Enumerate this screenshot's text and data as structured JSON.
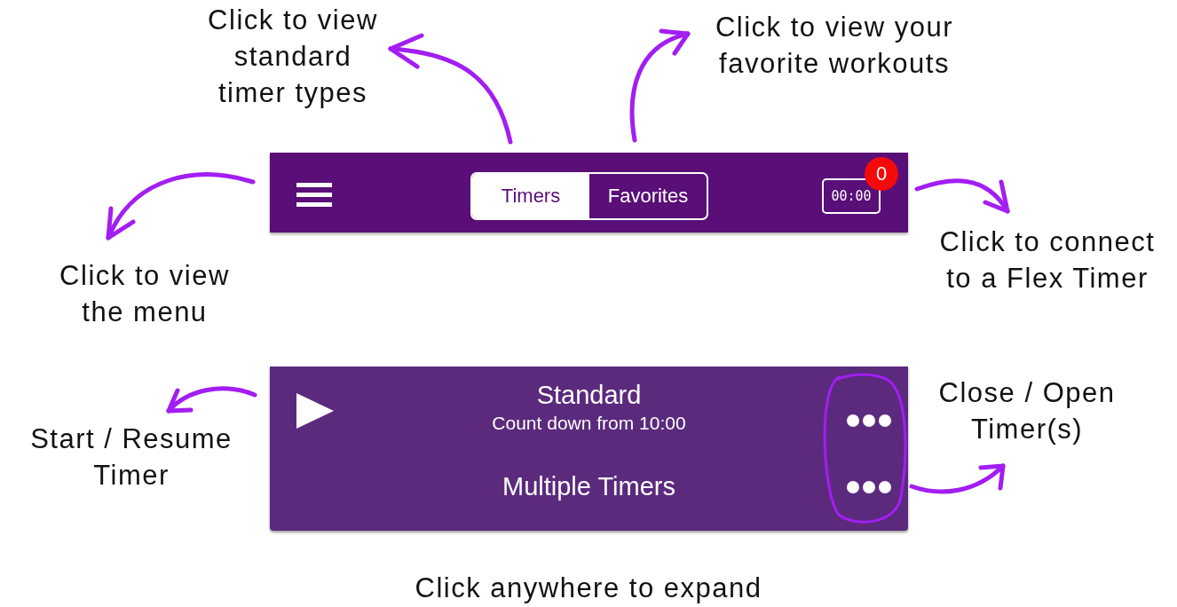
{
  "annotations": [
    {
      "kind": "tabs-note",
      "lines": [
        "Click to view",
        "standard",
        "timer types"
      ]
    },
    {
      "kind": "favorites-note",
      "lines": [
        "Click to view your",
        "favorite workouts"
      ]
    },
    {
      "kind": "menu-note",
      "lines": [
        "Click to view",
        "the menu"
      ]
    },
    {
      "kind": "connect-note",
      "lines": [
        "Click to connect",
        "to a Flex Timer"
      ]
    },
    {
      "kind": "start-note",
      "lines": [
        "Start / Resume",
        "Timer"
      ]
    },
    {
      "kind": "toggle-note",
      "lines": [
        "Close / Open",
        "Timer(s)"
      ]
    },
    {
      "kind": "expand-note",
      "lines": [
        "Click anywhere to expand"
      ]
    }
  ],
  "header": {
    "tabs": [
      {
        "label": "Timers",
        "selected": true
      },
      {
        "label": "Favorites",
        "selected": false
      }
    ],
    "timer_display": "00:00",
    "badge": "0"
  },
  "card": {
    "rows": [
      {
        "title": "Standard",
        "subtitle": "Count down from 10:00"
      },
      {
        "title": "Multiple Timers"
      }
    ]
  }
}
